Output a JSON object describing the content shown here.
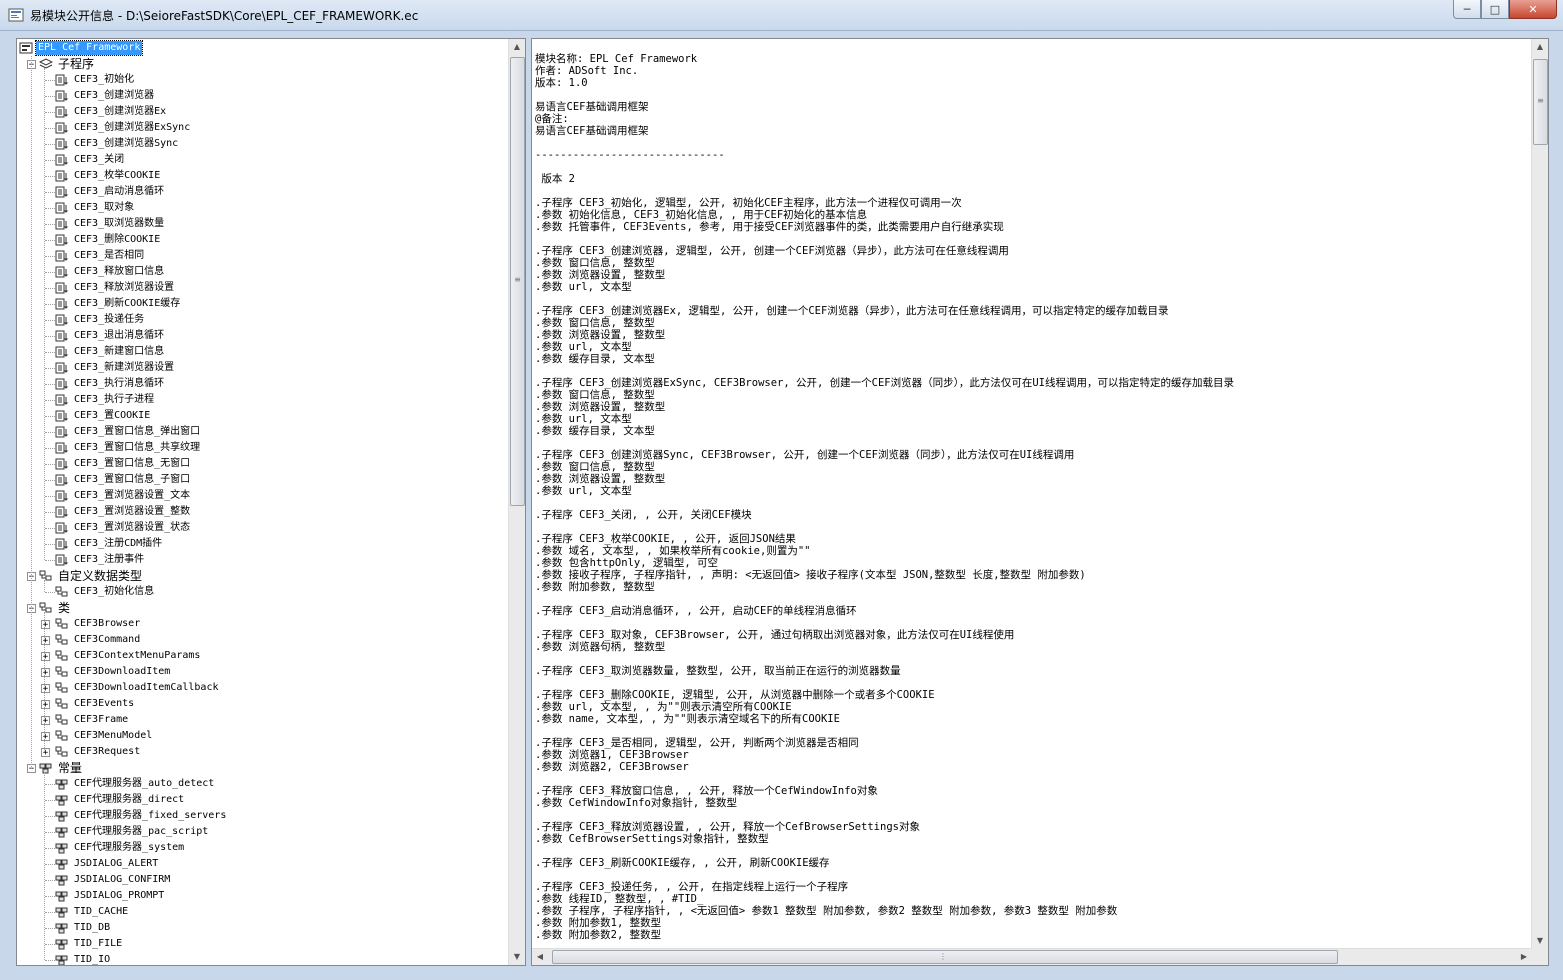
{
  "window": {
    "title": "易模块公开信息 - D:\\SeioreFastSDK\\Core\\EPL_CEF_FRAMEWORK.ec",
    "minimize_glyph": "─",
    "maximize_glyph": "□",
    "close_glyph": "✕"
  },
  "tree": {
    "root_label": "EPL Cef Framework",
    "groups": [
      {
        "label": "子程序",
        "icon": "layers-icon",
        "expander": "−",
        "items": [
          "CEF3_初始化",
          "CEF3_创建浏览器",
          "CEF3_创建浏览器Ex",
          "CEF3_创建浏览器ExSync",
          "CEF3_创建浏览器Sync",
          "CEF3_关闭",
          "CEF3_枚举COOKIE",
          "CEF3_启动消息循环",
          "CEF3_取对象",
          "CEF3_取浏览器数量",
          "CEF3_删除COOKIE",
          "CEF3_是否相同",
          "CEF3_释放窗口信息",
          "CEF3_释放浏览器设置",
          "CEF3_刷新COOKIE缓存",
          "CEF3_投递任务",
          "CEF3_退出消息循环",
          "CEF3_新建窗口信息",
          "CEF3_新建浏览器设置",
          "CEF3_执行消息循环",
          "CEF3_执行子进程",
          "CEF3_置COOKIE",
          "CEF3_置窗口信息_弹出窗口",
          "CEF3_置窗口信息_共享纹理",
          "CEF3_置窗口信息_无窗口",
          "CEF3_置窗口信息_子窗口",
          "CEF3_置浏览器设置_文本",
          "CEF3_置浏览器设置_整数",
          "CEF3_置浏览器设置_状态",
          "CEF3_注册CDM插件",
          "CEF3_注册事件"
        ]
      },
      {
        "label": "自定义数据类型",
        "icon": "datatype-icon",
        "expander": "−",
        "items": [
          "CEF3_初始化信息"
        ]
      },
      {
        "label": "类",
        "icon": "class-icon",
        "expander": "−",
        "items": [
          "CEF3Browser",
          "CEF3Command",
          "CEF3ContextMenuParams",
          "CEF3DownloadItem",
          "CEF3DownloadItemCallback",
          "CEF3Events",
          "CEF3Frame",
          "CEF3MenuModel",
          "CEF3Request"
        ]
      },
      {
        "label": "常量",
        "icon": "constants-icon",
        "expander": "−",
        "items": [
          "CEF代理服务器_auto_detect",
          "CEF代理服务器_direct",
          "CEF代理服务器_fixed_servers",
          "CEF代理服务器_pac_script",
          "CEF代理服务器_system",
          "JSDIALOG_ALERT",
          "JSDIALOG_CONFIRM",
          "JSDIALOG_PROMPT",
          "TID_CACHE",
          "TID_DB",
          "TID_FILE",
          "TID_IO"
        ]
      }
    ],
    "class_item_expander": "+"
  },
  "info": {
    "lines": [
      "模块名称: EPL Cef Framework",
      "作者: ADSoft Inc.",
      "版本: 1.0",
      "",
      "易语言CEF基础调用框架",
      "@备注:",
      "易语言CEF基础调用框架",
      "",
      "------------------------------",
      "",
      " 版本 2",
      "",
      ".子程序 CEF3_初始化, 逻辑型, 公开, 初始化CEF主程序，此方法一个进程仅可调用一次",
      ".参数 初始化信息, CEF3_初始化信息, , 用于CEF初始化的基本信息",
      ".参数 托管事件, CEF3Events, 参考, 用于接受CEF浏览器事件的类，此类需要用户自行继承实现",
      "",
      ".子程序 CEF3_创建浏览器, 逻辑型, 公开, 创建一个CEF浏览器（异步），此方法可在任意线程调用",
      ".参数 窗口信息, 整数型",
      ".参数 浏览器设置, 整数型",
      ".参数 url, 文本型",
      "",
      ".子程序 CEF3_创建浏览器Ex, 逻辑型, 公开, 创建一个CEF浏览器（异步），此方法可在任意线程调用，可以指定特定的缓存加载目录",
      ".参数 窗口信息, 整数型",
      ".参数 浏览器设置, 整数型",
      ".参数 url, 文本型",
      ".参数 缓存目录, 文本型",
      "",
      ".子程序 CEF3_创建浏览器ExSync, CEF3Browser, 公开, 创建一个CEF浏览器（同步），此方法仅可在UI线程调用，可以指定特定的缓存加载目录",
      ".参数 窗口信息, 整数型",
      ".参数 浏览器设置, 整数型",
      ".参数 url, 文本型",
      ".参数 缓存目录, 文本型",
      "",
      ".子程序 CEF3_创建浏览器Sync, CEF3Browser, 公开, 创建一个CEF浏览器（同步），此方法仅可在UI线程调用",
      ".参数 窗口信息, 整数型",
      ".参数 浏览器设置, 整数型",
      ".参数 url, 文本型",
      "",
      ".子程序 CEF3_关闭, , 公开, 关闭CEF模块",
      "",
      ".子程序 CEF3_枚举COOKIE, , 公开, 返回JSON结果",
      ".参数 域名, 文本型, , 如果枚举所有cookie,则置为\"\"",
      ".参数 包含httpOnly, 逻辑型, 可空",
      ".参数 接收子程序, 子程序指针, , 声明: <无返回值> 接收子程序(文本型 JSON,整数型 长度,整数型 附加参数)",
      ".参数 附加参数, 整数型",
      "",
      ".子程序 CEF3_启动消息循环, , 公开, 启动CEF的单线程消息循环",
      "",
      ".子程序 CEF3_取对象, CEF3Browser, 公开, 通过句柄取出浏览器对象，此方法仅可在UI线程使用",
      ".参数 浏览器句柄, 整数型",
      "",
      ".子程序 CEF3_取浏览器数量, 整数型, 公开, 取当前正在运行的浏览器数量",
      "",
      ".子程序 CEF3_删除COOKIE, 逻辑型, 公开, 从浏览器中删除一个或者多个COOKIE",
      ".参数 url, 文本型, , 为\"\"则表示清空所有COOKIE",
      ".参数 name, 文本型, , 为\"\"则表示清空域名下的所有COOKIE",
      "",
      ".子程序 CEF3_是否相同, 逻辑型, 公开, 判断两个浏览器是否相同",
      ".参数 浏览器1, CEF3Browser",
      ".参数 浏览器2, CEF3Browser",
      "",
      ".子程序 CEF3_释放窗口信息, , 公开, 释放一个CefWindowInfo对象",
      ".参数 CefWindowInfo对象指针, 整数型",
      "",
      ".子程序 CEF3_释放浏览器设置, , 公开, 释放一个CefBrowserSettings对象",
      ".参数 CefBrowserSettings对象指针, 整数型",
      "",
      ".子程序 CEF3_刷新COOKIE缓存, , 公开, 刷新COOKIE缓存",
      "",
      ".子程序 CEF3_投递任务, , 公开, 在指定线程上运行一个子程序",
      ".参数 线程ID, 整数型, , #TID_",
      ".参数 子程序, 子程序指针, , <无返回值> 参数1 整数型 附加参数, 参数2 整数型 附加参数, 参数3 整数型 附加参数",
      ".参数 附加参数1, 整数型",
      ".参数 附加参数2, 整数型"
    ]
  }
}
